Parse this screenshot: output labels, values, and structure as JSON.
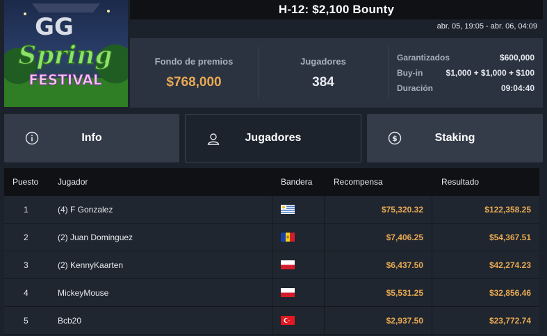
{
  "header": {
    "title": "H-12: $2,100 Bounty",
    "dates": "abr. 05, 19:05 - abr. 06, 04:09",
    "logo": {
      "line1": "GG",
      "line2": "Spring",
      "line3": "FESTIVAL"
    }
  },
  "stats": {
    "prize_pool_label": "Fondo de premios",
    "prize_pool_value": "$768,000",
    "players_label": "Jugadores",
    "players_value": "384",
    "guaranteed_label": "Garantizados",
    "guaranteed_value": "$600,000",
    "buyin_label": "Buy-in",
    "buyin_value": "$1,000 + $1,000 + $100",
    "duration_label": "Duración",
    "duration_value": "09:04:40"
  },
  "tabs": [
    {
      "label": "Info",
      "icon": "info-icon"
    },
    {
      "label": "Jugadores",
      "icon": "user-icon",
      "active": true
    },
    {
      "label": "Staking",
      "icon": "dollar-coin-icon"
    }
  ],
  "table": {
    "columns": [
      "Puesto",
      "Jugador",
      "Bandera",
      "Recompensa",
      "Resultado"
    ],
    "rows": [
      {
        "pos": "1",
        "player": "(4) F Gonzalez",
        "flag": "uruguay",
        "reward": "$75,320.32",
        "result": "$122,358.25"
      },
      {
        "pos": "2",
        "player": "(2) Juan Dominguez",
        "flag": "andorra",
        "reward": "$7,406.25",
        "result": "$54,367.51"
      },
      {
        "pos": "3",
        "player": "(2) KennyKaarten",
        "flag": "poland",
        "reward": "$6,437.50",
        "result": "$42,274.23"
      },
      {
        "pos": "4",
        "player": "MickeyMouse",
        "flag": "poland",
        "reward": "$5,531.25",
        "result": "$32,856.46"
      },
      {
        "pos": "5",
        "player": "Bcb20",
        "flag": "turkey",
        "reward": "$2,937.50",
        "result": "$23,772.74"
      }
    ]
  },
  "colors": {
    "accent_gold": "#e9a953",
    "panel": "#2b3340",
    "background": "#1c222b"
  }
}
